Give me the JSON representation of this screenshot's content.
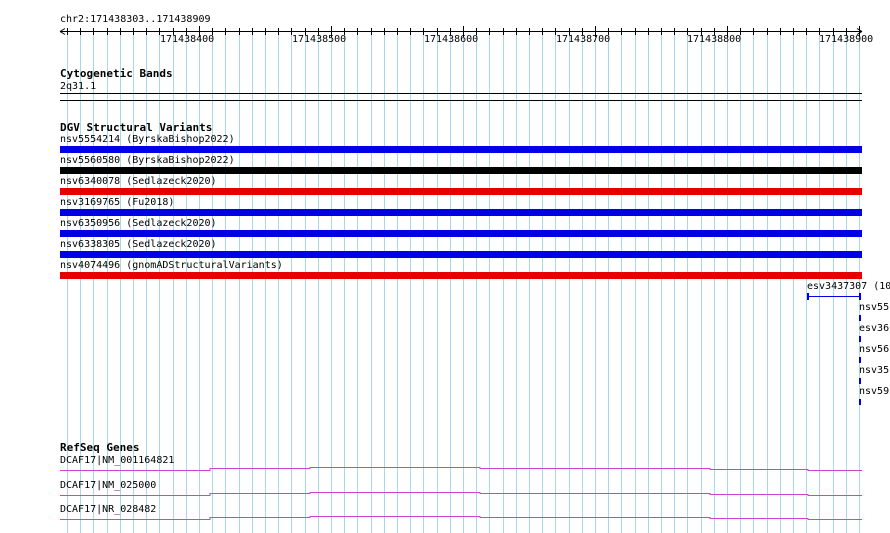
{
  "window": {
    "location": "chr2:171438303..171438909"
  },
  "ruler": {
    "ticks": [
      "171438400",
      "171438500",
      "171438600",
      "171438700",
      "171438800",
      "171438900"
    ]
  },
  "cytobands": {
    "title": "Cytogenetic Bands",
    "band": "2q31.1"
  },
  "dgv": {
    "title": "DGV Structural Variants",
    "variants": [
      {
        "label": "nsv5554214 (ByrskaBishop2022)",
        "color": "#0000e6"
      },
      {
        "label": "nsv5560580 (ByrskaBishop2022)",
        "color": "#000000"
      },
      {
        "label": "nsv6340078 (Sedlazeck2020)",
        "color": "#e60000"
      },
      {
        "label": "nsv3169765 (Fu2018)",
        "color": "#0000e6"
      },
      {
        "label": "nsv6350956 (Sedlazeck2020)",
        "color": "#0000e6"
      },
      {
        "label": "nsv6338305 (Sedlazeck2020)",
        "color": "#0000e6"
      },
      {
        "label": "nsv4074496 (gnomADStructuralVariants)",
        "color": "#e60000"
      }
    ],
    "small_variants": [
      {
        "label": "esv3437307 (10"
      },
      {
        "label": "nsv55"
      },
      {
        "label": "esv36"
      },
      {
        "label": "nsv56"
      },
      {
        "label": "nsv35"
      },
      {
        "label": "nsv59"
      }
    ],
    "small_color": "#0000e6"
  },
  "refseq": {
    "title": "RefSeq Genes",
    "genes": [
      {
        "label": "DCAF17|NM_001164821"
      },
      {
        "label": "DCAF17|NM_025000"
      },
      {
        "label": "DCAF17|NR_028482"
      }
    ],
    "gene_color": "#cc44cc"
  },
  "colors": {
    "grid": "#a8d8ea"
  }
}
